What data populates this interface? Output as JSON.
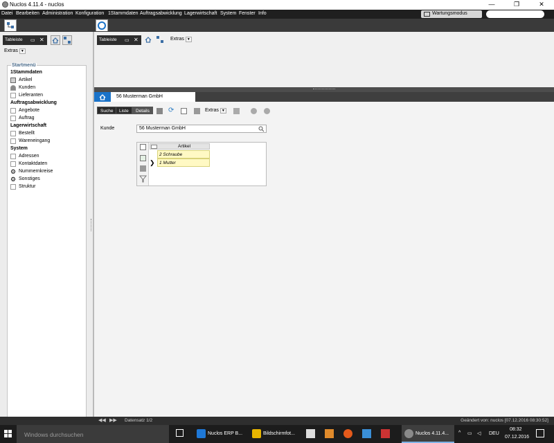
{
  "window": {
    "title": "Nuclos 4.11.4 - nuclos",
    "minimize": "—",
    "maximize": "❐",
    "close": "✕"
  },
  "menu": [
    "Datei",
    "Bearbeiten",
    "Administration",
    "Konfiguration",
    "1Stammdaten",
    "Auftragsabwicklung",
    "Lagerwirtschaft",
    "System",
    "Fenster",
    "Info"
  ],
  "maintenance_label": "Wartungsmodus",
  "search_placeholder": "",
  "left_toolbar": {
    "label": "Tableiste",
    "extras": "Extras"
  },
  "top_toolbar": {
    "label": "Tableiste",
    "extras": "Extras"
  },
  "startmenu": {
    "title": "Startmenü",
    "groups": [
      {
        "label": "1Stammdaten",
        "items": [
          "Artikel",
          "Kunden",
          "Lieferanten"
        ]
      },
      {
        "label": "Auftragsabwicklung",
        "items": [
          "Angebote",
          "Auftrag"
        ]
      },
      {
        "label": "Lagerwirtschaft",
        "items": [
          "Bestellt",
          "Wareneingang"
        ]
      },
      {
        "label": "System",
        "items": [
          "Adressen",
          "Kontaktdaten",
          "Nummernkreise",
          "Sonstiges",
          "Struktur"
        ]
      }
    ]
  },
  "detail": {
    "tab_title": "56  Musterman GmbH",
    "segments": [
      "Suche",
      "Liste",
      "Details"
    ],
    "extras": "Extras",
    "customer_label": "Kunde",
    "customer_value": "56  Musterman GmbH",
    "subform": {
      "column": "Artikel",
      "rows": [
        "2 Schraube",
        "1 Mutter"
      ]
    }
  },
  "status": {
    "record": "Datensatz 1/2",
    "changed": "Geändert von: nuclos [07.12.2016 08:30:52]"
  },
  "taskbar": {
    "search": "Windows durchsuchen",
    "tasks": [
      "Nuclos ERP B...",
      "Bildschirmfot...",
      "Nuclos 4.11.4..."
    ],
    "language": "DEU",
    "time": "08:32",
    "date": "07.12.2016"
  },
  "colors": {
    "accent": "#1a73c9",
    "menubar": "#1f1f1f",
    "row_highlight": "#fff9c4"
  }
}
